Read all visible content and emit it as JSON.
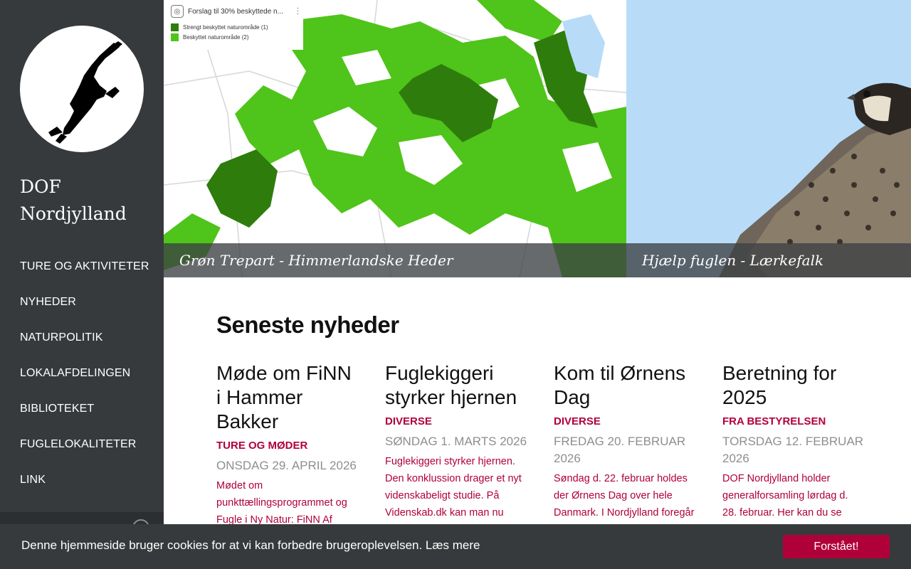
{
  "site": {
    "title": "DOF Nordjylland",
    "logo_icon": "eagle-logo"
  },
  "nav": {
    "items": [
      {
        "label": "TURE OG AKTIVITETER"
      },
      {
        "label": "NYHEDER"
      },
      {
        "label": "NATURPOLITIK"
      },
      {
        "label": "LOKALAFDELINGEN"
      },
      {
        "label": "BIBLIOTEKET"
      },
      {
        "label": "FUGLELOKALITETER"
      },
      {
        "label": "LINK"
      }
    ]
  },
  "hero": {
    "slides": [
      {
        "caption": "Grøn Trepart - Himmerlandske Heder",
        "legend": {
          "title": "Forslag til 30% beskyttede n...",
          "items": [
            {
              "label": "Strengt beskyttet naturområde (1)",
              "color": "#2e7d0c"
            },
            {
              "label": "Beskyttet naturområde (2)",
              "color": "#4fc41a"
            }
          ]
        }
      },
      {
        "caption": "Hjælp fuglen - Lærkefalk"
      }
    ]
  },
  "news": {
    "heading": "Seneste nyheder",
    "items": [
      {
        "title": "Møde om FiNN i Hammer Bakker",
        "category": "TURE OG MØDER",
        "date": "ONSDAG 29. APRIL 2026",
        "excerpt": "Mødet om punkttællingsprogrammet og Fugle i Ny Natur: FiNN Af Svend"
      },
      {
        "title": "Fuglekiggeri styrker hjernen",
        "category": "DIVERSE",
        "date": "SØNDAG 1. MARTS 2026",
        "excerpt": "Fuglekiggeri styrker hjernen. Den konklussion drager et nyt videnskabeligt studie. På Videnskab.dk kan man nu læse"
      },
      {
        "title": "Kom til Ørnens Dag",
        "category": "DIVERSE",
        "date": "FREDAG 20. FEBRUAR 2026",
        "excerpt": "Søndag d. 22. februar holdes der Ørnens Dag over hele Danmark. I Nordjylland foregår"
      },
      {
        "title": "Beretning for 2025",
        "category": "FRA BESTYRELSEN",
        "date": "TORSDAG 12. FEBRUAR 2026",
        "excerpt": "DOF Nordjylland holder generalforsamling lørdag d. 28. februar. Her kan du se"
      }
    ]
  },
  "cookie": {
    "message": "Denne hjemmeside bruger cookies for at vi kan forbedre brugeroplevelsen. Læs mere",
    "button": "Forstået!"
  },
  "colors": {
    "accent": "#b0003a",
    "sidebar": "#373a3c"
  }
}
